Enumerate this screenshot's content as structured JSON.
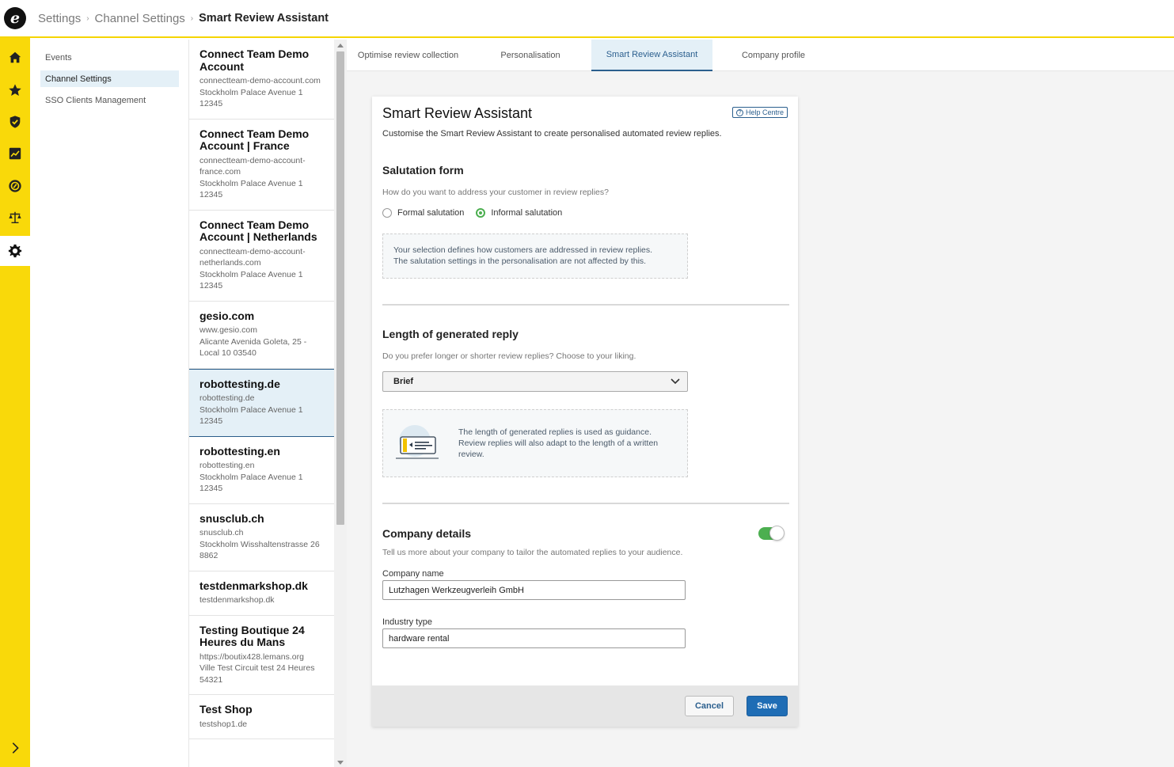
{
  "breadcrumb": {
    "items": [
      "Settings",
      "Channel Settings"
    ],
    "current": "Smart Review Assistant",
    "separator": "›"
  },
  "logo": {
    "letter": "e"
  },
  "rail": {
    "icons": [
      "home-icon",
      "star-icon",
      "shield-check-icon",
      "chart-icon",
      "trusted-badge-icon",
      "scale-icon",
      "gear-icon"
    ],
    "active": "gear-icon",
    "expand_icon": "chevron-right-icon",
    "color": "#f9d90a"
  },
  "settings_nav": {
    "items": [
      "Events",
      "Channel Settings",
      "SSO Clients Management"
    ],
    "active": "Channel Settings"
  },
  "channels": [
    {
      "name": "Connect Team Demo Account",
      "lines": [
        "connectteam-demo-account.com",
        "Stockholm Palace Avenue 1",
        "12345"
      ]
    },
    {
      "name": "Connect Team Demo Account | France",
      "lines": [
        "connectteam-demo-account-france.com",
        "Stockholm Palace Avenue 1",
        "12345"
      ]
    },
    {
      "name": "Connect Team Demo Account | Netherlands",
      "lines": [
        "connectteam-demo-account-netherlands.com",
        "Stockholm Palace Avenue 1",
        "12345"
      ]
    },
    {
      "name": "gesio.com",
      "lines": [
        "www.gesio.com",
        "Alicante Avenida Goleta, 25 - Local 10 03540"
      ]
    },
    {
      "name": "robottesting.de",
      "lines": [
        "robottesting.de",
        "Stockholm Palace Avenue 1",
        "12345"
      ],
      "active": true
    },
    {
      "name": "robottesting.en",
      "lines": [
        "robottesting.en",
        "Stockholm Palace Avenue 1",
        "12345"
      ]
    },
    {
      "name": "snusclub.ch",
      "lines": [
        "snusclub.ch",
        "Stockholm Wisshaltenstrasse 26 8862"
      ]
    },
    {
      "name": "testdenmarkshop.dk",
      "lines": [
        "testdenmarkshop.dk"
      ]
    },
    {
      "name": "Testing Boutique 24 Heures du Mans",
      "lines": [
        "https://boutix428.lemans.org",
        "Ville Test Circuit test 24 Heures 54321"
      ]
    },
    {
      "name": "Test Shop",
      "lines": [
        "testshop1.de"
      ]
    }
  ],
  "tabs": [
    "Optimise review collection",
    "Personalisation",
    "Smart Review Assistant",
    "Company profile"
  ],
  "active_tab": "Smart Review Assistant",
  "card": {
    "title": "Smart Review Assistant",
    "help_label": "Help Centre",
    "subtitle": "Customise the Smart Review Assistant to create personalised automated review replies.",
    "salutation": {
      "title": "Salutation form",
      "question": "How do you want to address your customer in review replies?",
      "options": [
        "Formal salutation",
        "Informal salutation"
      ],
      "selected": "Informal salutation",
      "info_line1": "Your selection defines how customers are addressed in review replies.",
      "info_line2": "The salutation settings in the personalisation are not affected by this."
    },
    "length": {
      "title": "Length of generated reply",
      "question": "Do you prefer longer or shorter review replies? Choose to your liking.",
      "selected": "Brief",
      "info": "The length of generated replies is used as guidance. Review replies will also adapt to the length of a written review."
    },
    "company": {
      "title": "Company details",
      "description": "Tell us more about your company to tailor the automated replies to your audience.",
      "toggle_on": true,
      "name_label": "Company name",
      "name_value": "Lutzhagen Werkzeugverleih GmbH",
      "industry_label": "Industry type",
      "industry_value": "hardware rental"
    },
    "cancel_label": "Cancel",
    "save_label": "Save"
  },
  "colors": {
    "accent_yellow": "#f9d90a",
    "primary_blue": "#1f6db5",
    "active_bg": "#e4f0f7",
    "toggle_green": "#4caf50"
  }
}
